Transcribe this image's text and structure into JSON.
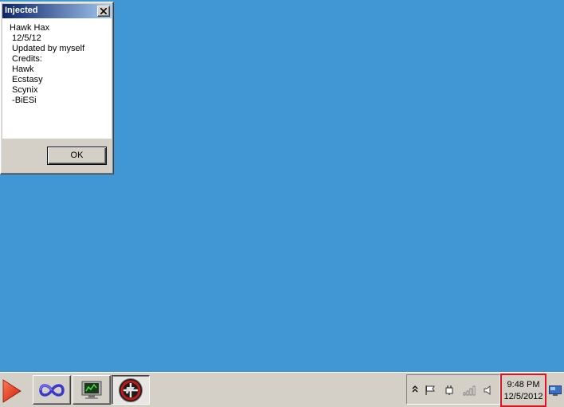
{
  "desktop": {
    "background_color": "#4196d4"
  },
  "dialog": {
    "title": "Injected",
    "message_lines": [
      "Hawk Hax",
      " 12/5/12",
      " Updated by myself",
      " Credits:",
      " Hawk",
      " Ecstasy",
      " Scynix",
      " -BiESi"
    ],
    "ok_label": "OK",
    "close_icon": "close-icon"
  },
  "taskbar": {
    "start_icon": "play-arrow-icon",
    "buttons": [
      {
        "name": "infinity-app",
        "icon": "infinity-icon",
        "active": false
      },
      {
        "name": "monitor-app",
        "icon": "monitor-icon",
        "active": false
      },
      {
        "name": "crossfire-app",
        "icon": "crossfire-logo-icon",
        "active": true
      }
    ],
    "tray_icons": [
      "chevron-up-icon",
      "flag-icon",
      "power-plug-icon",
      "signal-bars-icon",
      "speaker-icon"
    ],
    "clock": {
      "time": "9:48 PM",
      "date": "12/5/2012"
    },
    "show_desktop_icon": "show-desktop-icon"
  }
}
